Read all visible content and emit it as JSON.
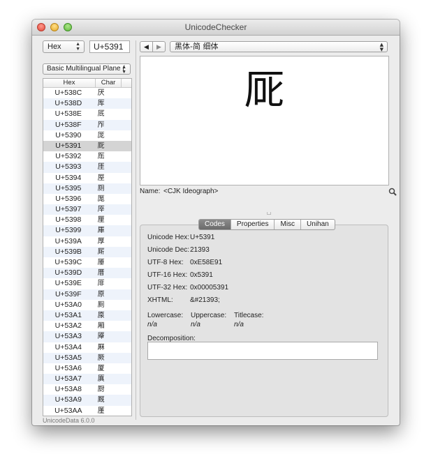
{
  "window": {
    "title": "UnicodeChecker"
  },
  "left_panel": {
    "format_select": "Hex",
    "code_field": "U+5391",
    "block_select": "Basic Multilingual Plane (",
    "table": {
      "headers": [
        "Hex",
        "Char"
      ],
      "rows": [
        {
          "hex": "U+538C",
          "char": "厌"
        },
        {
          "hex": "U+538D",
          "char": "厍"
        },
        {
          "hex": "U+538E",
          "char": "厎"
        },
        {
          "hex": "U+538F",
          "char": "厏"
        },
        {
          "hex": "U+5390",
          "char": "厐"
        },
        {
          "hex": "U+5391",
          "char": "厑"
        },
        {
          "hex": "U+5392",
          "char": "厒"
        },
        {
          "hex": "U+5393",
          "char": "厓"
        },
        {
          "hex": "U+5394",
          "char": "厔"
        },
        {
          "hex": "U+5395",
          "char": "厕"
        },
        {
          "hex": "U+5396",
          "char": "厖"
        },
        {
          "hex": "U+5397",
          "char": "厗"
        },
        {
          "hex": "U+5398",
          "char": "厘"
        },
        {
          "hex": "U+5399",
          "char": "厙"
        },
        {
          "hex": "U+539A",
          "char": "厚"
        },
        {
          "hex": "U+539B",
          "char": "厛"
        },
        {
          "hex": "U+539C",
          "char": "厜"
        },
        {
          "hex": "U+539D",
          "char": "厝"
        },
        {
          "hex": "U+539E",
          "char": "厞"
        },
        {
          "hex": "U+539F",
          "char": "原"
        },
        {
          "hex": "U+53A0",
          "char": "厠"
        },
        {
          "hex": "U+53A1",
          "char": "厡"
        },
        {
          "hex": "U+53A2",
          "char": "厢"
        },
        {
          "hex": "U+53A3",
          "char": "厣"
        },
        {
          "hex": "U+53A4",
          "char": "厤"
        },
        {
          "hex": "U+53A5",
          "char": "厥"
        },
        {
          "hex": "U+53A6",
          "char": "厦"
        },
        {
          "hex": "U+53A7",
          "char": "厧"
        },
        {
          "hex": "U+53A8",
          "char": "厨"
        },
        {
          "hex": "U+53A9",
          "char": "厩"
        },
        {
          "hex": "U+53AA",
          "char": "厪"
        }
      ],
      "selected_hex": "U+5391"
    },
    "footer": "UnicodeData 6.0.0"
  },
  "right_panel": {
    "nav_back": "◀",
    "nav_forward": "▶",
    "font_select": "黑体-简 细体",
    "preview_char": "厑",
    "name_label": "Name:",
    "name_value": "<CJK Ideograph>",
    "tabs": [
      "Codes",
      "Properties",
      "Misc",
      "Unihan"
    ],
    "active_tab": "Codes",
    "codes": {
      "unicode_hex_label": "Unicode Hex:",
      "unicode_hex_value": "U+5391",
      "unicode_dec_label": "Unicode Dec:",
      "unicode_dec_value": "21393",
      "utf8_label": "UTF-8 Hex:",
      "utf8_value": "0xE58E91",
      "utf16_label": "UTF-16 Hex:",
      "utf16_value": "0x5391",
      "utf32_label": "UTF-32 Hex:",
      "utf32_value": "0x00005391",
      "xhtml_label": "XHTML:",
      "xhtml_value": "&#21393;",
      "lowercase_label": "Lowercase:",
      "lowercase_value": "n/a",
      "uppercase_label": "Uppercase:",
      "uppercase_value": "n/a",
      "titlecase_label": "Titlecase:",
      "titlecase_value": "n/a",
      "decomposition_label": "Decomposition:",
      "decomposition_value": ""
    }
  },
  "icons": {
    "search": "magnifier-icon"
  },
  "colors": {
    "selected_row": "#d4d4d4",
    "stripe_row": "#eef3fb",
    "active_tab": "#7a7a7a"
  }
}
